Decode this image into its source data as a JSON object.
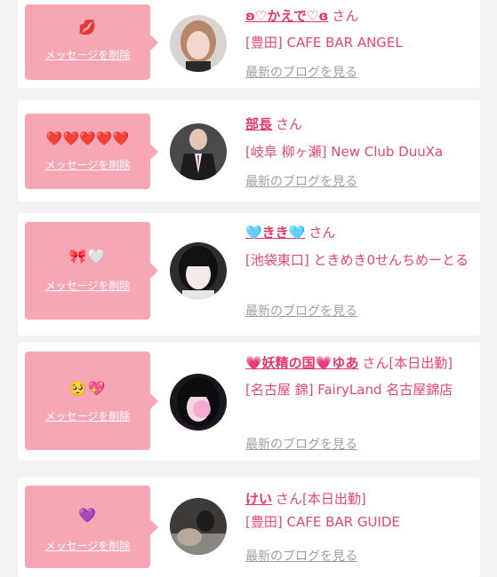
{
  "items": [
    {
      "message": "💋",
      "delete_label": "メッセージを削除",
      "name": "ʚ♡かえで♡ɞ",
      "honorific": "さん",
      "extra": "",
      "shop": "[豊田] CAFE BAR ANGEL",
      "blog_link": "最新のブログを見る",
      "avatar_colors": [
        "#d9d4d0",
        "#6e5a52"
      ]
    },
    {
      "message": "❤️❤️❤️❤️❤️",
      "delete_label": "メッセージを削除",
      "name": "部長",
      "honorific": "さん",
      "extra": "",
      "shop": "[岐阜 柳ヶ瀬] New Club DuuXa",
      "blog_link": "最新のブログを見る",
      "avatar_colors": [
        "#3a3a3c",
        "#1c1c1e"
      ]
    },
    {
      "message": "🎀🤍",
      "delete_label": "メッセージを削除",
      "name": "🩵きき🩵",
      "honorific": "さん",
      "extra": "",
      "shop": "[池袋東口] ときめき0せんちめーとる",
      "blog_link": "最新のブログを見る",
      "avatar_colors": [
        "#2a2f2c",
        "#eae4e2"
      ]
    },
    {
      "message": "🥺💖",
      "delete_label": "メッセージを削除",
      "name": "💗妖精の国💗ゆあ",
      "honorific": "さん",
      "extra": "[本日出勤]",
      "shop": "[名古屋 錦] FairyLand 名古屋錦店",
      "blog_link": "最新のブログを見る",
      "avatar_colors": [
        "#1b1620",
        "#f2a0d0"
      ]
    },
    {
      "message": "💜",
      "delete_label": "メッセージを削除",
      "name": "けい",
      "honorific": "さん",
      "extra": "[本日出勤]",
      "shop": "[豊田] CAFE BAR GUIDE",
      "blog_link": "最新のブログを見る",
      "avatar_colors": [
        "#3d3a37",
        "#8a8682"
      ]
    }
  ]
}
